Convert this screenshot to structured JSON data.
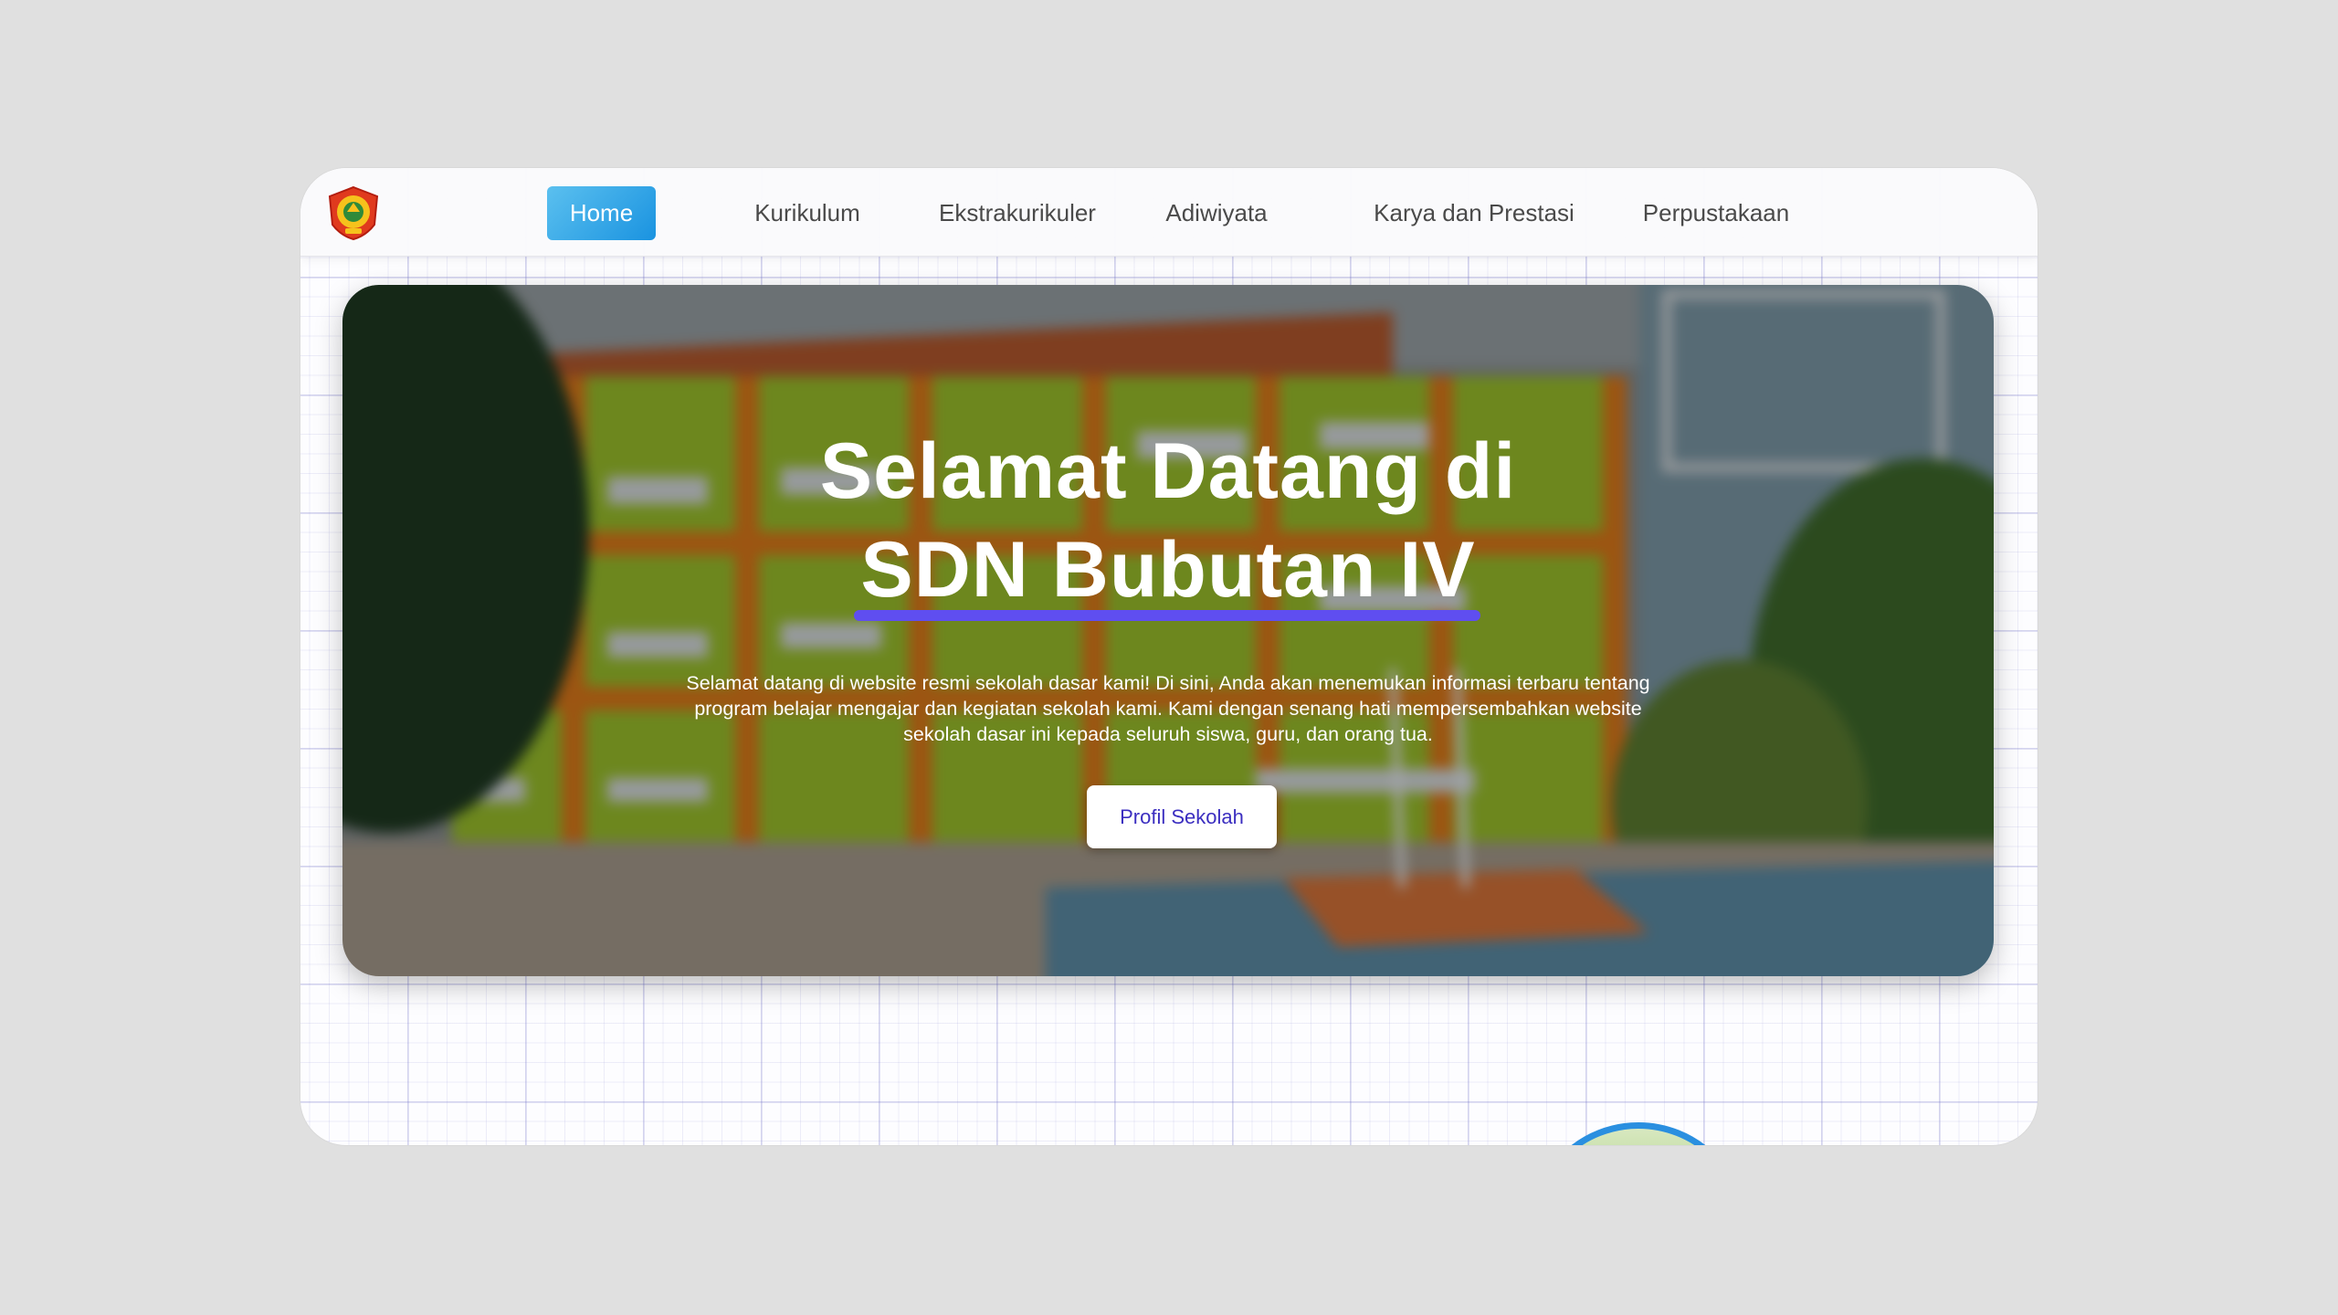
{
  "nav": {
    "items": [
      {
        "label": "Home",
        "active": true
      },
      {
        "label": "Kurikulum"
      },
      {
        "label": "Ekstrakurikuler"
      },
      {
        "label": "Adiwiyata"
      },
      {
        "label": "Karya dan Prestasi"
      },
      {
        "label": "Perpustakaan"
      }
    ],
    "active_gradient": [
      "#5bc0ef",
      "#1a93e0"
    ]
  },
  "logo": {
    "icon": "school-emblem-icon"
  },
  "hero": {
    "title_line1": "Selamat Datang di",
    "title_line2": "SDN Bubutan IV",
    "description": "Selamat datang di website resmi sekolah dasar kami! Di sini, Anda akan menemukan informasi terbaru tentang program belajar mengajar dan kegiatan sekolah kami. Kami dengan senang hati mempersembahkan website sekolah dasar ini kepada seluruh siswa, guru, dan orang tua.",
    "cta_label": "Profil Sekolah",
    "underline_color": "#5f4ef0"
  },
  "colors": {
    "page_bg": "#e0e0e0",
    "cta_text": "#3b2ec0"
  }
}
